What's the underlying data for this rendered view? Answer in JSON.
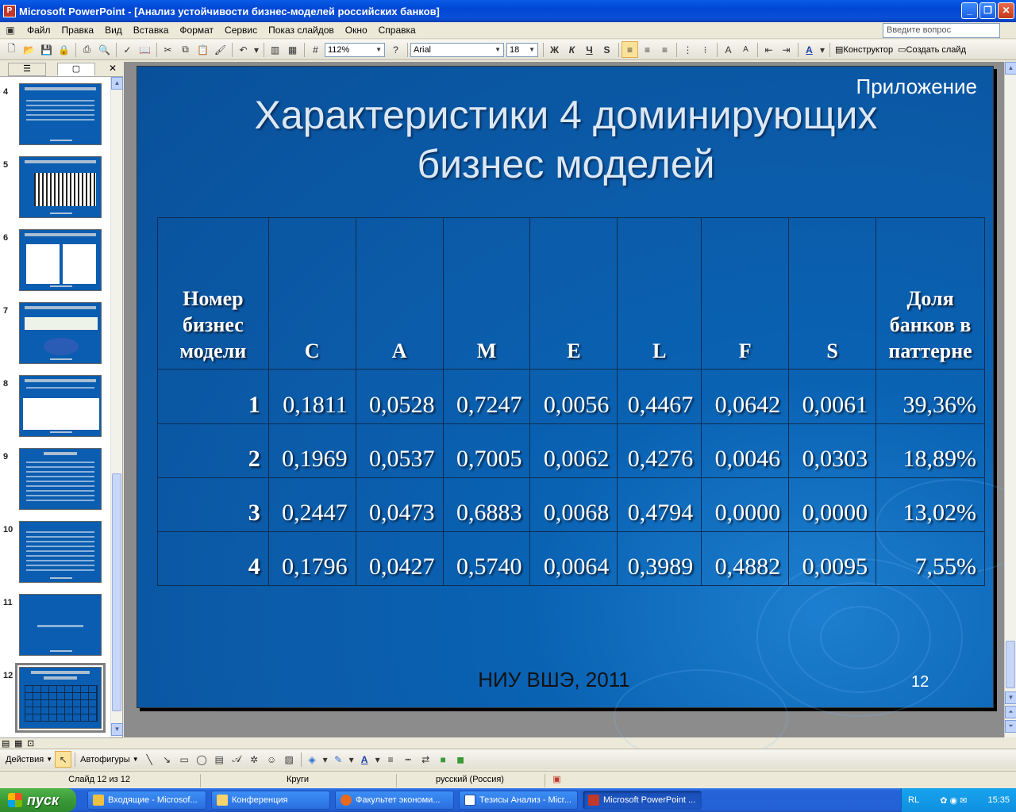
{
  "window": {
    "title": "Microsoft PowerPoint - [Анализ устойчивости бизнес-моделей российских банков]",
    "app_icon": "powerpoint-icon",
    "minimize": "_",
    "maximize": "❐",
    "close": "✕"
  },
  "menu": {
    "items": [
      "Файл",
      "Правка",
      "Вид",
      "Вставка",
      "Формат",
      "Сервис",
      "Показ слайдов",
      "Окно",
      "Справка"
    ],
    "help_placeholder": "Введите вопрос"
  },
  "toolbar": {
    "zoom": "112%",
    "font": "Arial",
    "font_size": "18",
    "bold": "Ж",
    "italic": "К",
    "underline": "Ч",
    "shadow": "S",
    "designer": "Конструктор",
    "new_slide": "Создать слайд"
  },
  "thumbnails": [
    {
      "num": "4"
    },
    {
      "num": "5"
    },
    {
      "num": "6"
    },
    {
      "num": "7"
    },
    {
      "num": "8"
    },
    {
      "num": "9"
    },
    {
      "num": "10"
    },
    {
      "num": "11"
    },
    {
      "num": "12"
    }
  ],
  "slide": {
    "appendix": "Приложение",
    "title_line1": "Характеристики 4 доминирующих",
    "title_line2": "бизнес моделей",
    "footer": "НИУ ВШЭ, 2011",
    "number": "12",
    "table": {
      "headers": [
        "Номер бизнес модели",
        "C",
        "A",
        "M",
        "E",
        "L",
        "F",
        "S",
        "Доля банков в паттерне"
      ],
      "rows": [
        [
          "1",
          "0,1811",
          "0,0528",
          "0,7247",
          "0,0056",
          "0,4467",
          "0,0642",
          "0,0061",
          "39,36%"
        ],
        [
          "2",
          "0,1969",
          "0,0537",
          "0,7005",
          "0,0062",
          "0,4276",
          "0,0046",
          "0,0303",
          "18,89%"
        ],
        [
          "3",
          "0,2447",
          "0,0473",
          "0,6883",
          "0,0068",
          "0,4794",
          "0,0000",
          "0,0000",
          "13,02%"
        ],
        [
          "4",
          "0,1796",
          "0,0427",
          "0,5740",
          "0,0064",
          "0,3989",
          "0,4882",
          "0,0095",
          "7,55%"
        ]
      ]
    }
  },
  "drawing": {
    "actions": "Действия",
    "autoshapes": "Автофигуры"
  },
  "status": {
    "slide": "Слайд 12 из 12",
    "design": "Круги",
    "language": "русский (Россия)"
  },
  "taskbar": {
    "start": "пуск",
    "tasks": [
      "Входящие - Microsof...",
      "Конференция",
      "Факультет экономи...",
      "Тезисы Анализ - Micr...",
      "Microsoft PowerPoint ..."
    ],
    "lang": "RL",
    "clock": "15:35"
  },
  "colors": {
    "slide_bg": "#0a5db0",
    "title_bar": "#0046d5",
    "taskbar": "#2461d6",
    "start_green": "#3a9a37"
  }
}
